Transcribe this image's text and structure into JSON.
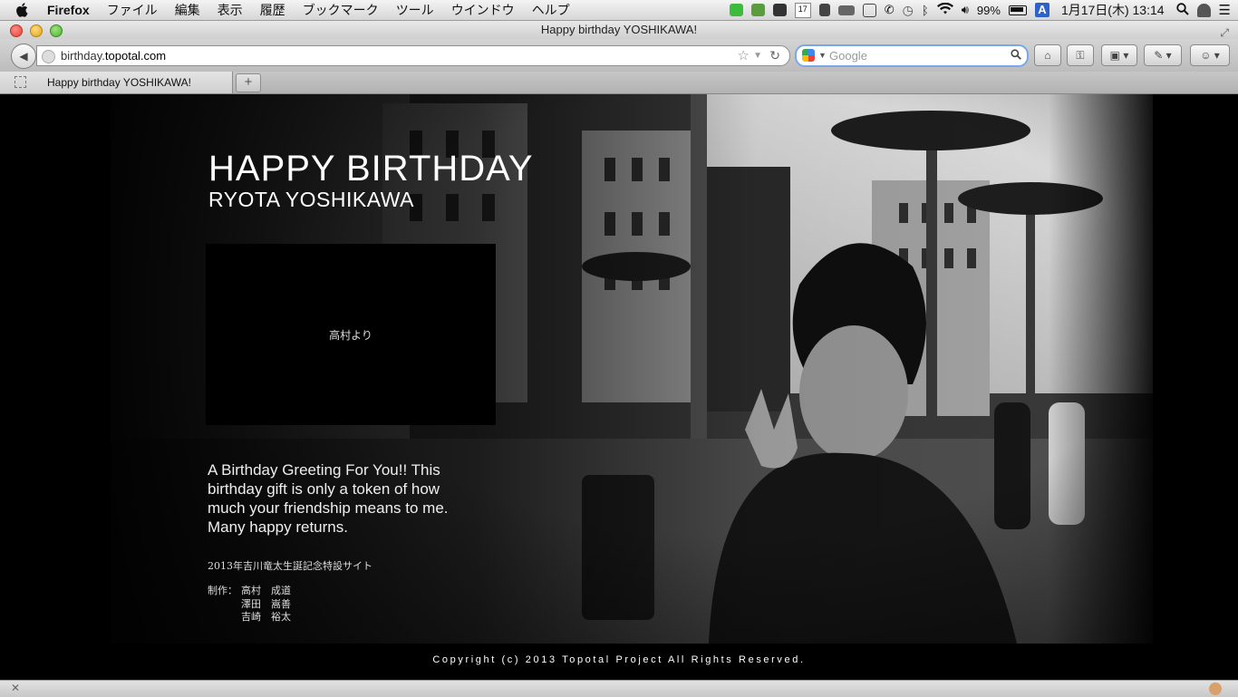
{
  "menubar": {
    "app": "Firefox",
    "items": [
      "ファイル",
      "編集",
      "表示",
      "履歴",
      "ブックマーク",
      "ツール",
      "ウインドウ",
      "ヘルプ"
    ],
    "calendar_day": "17",
    "battery": "99%",
    "input_method": "A",
    "clock": "1月17日(木)  13:14"
  },
  "window": {
    "title": "Happy birthday YOSHIKAWA!"
  },
  "navbar": {
    "url_prefix": "birthday.",
    "url_domain": "topotal.com",
    "search_placeholder": "Google"
  },
  "tabs": [
    {
      "label": "Happy birthday YOSHIKAWA!",
      "active": true
    }
  ],
  "newtab_label": "+",
  "page": {
    "headline": "HAPPY BIRTHDAY",
    "subline": "RYOTA YOSHIKAWA",
    "message_from": "高村より",
    "greeting": "A Birthday Greeting For You!! This birthday gift is only a token of how much your friendship means to me. Many happy returns.",
    "site_note": "2013年吉川竜太生誕記念特設サイト",
    "credits_label": "制作：",
    "credits": [
      "高村　成道",
      "澤田　嵩善",
      "吉崎　裕太"
    ],
    "copyright": "Copyright (c) 2013 Topotal Project All Rights Reserved."
  },
  "colors": {
    "page_bg": "#000000",
    "text": "#ffffff",
    "search_focus": "#7aa7e6"
  },
  "icons": [
    "apple-icon",
    "line-icon",
    "evernote-icon",
    "adobe-icon",
    "calendar-icon",
    "clipboard-icon",
    "airplay-icon",
    "grid-icon",
    "phone-icon",
    "time-machine-icon",
    "bluetooth-icon",
    "wifi-icon",
    "volume-icon",
    "battery-icon",
    "user-icon",
    "spotlight-icon",
    "list-icon",
    "back-icon",
    "globe-icon",
    "star-icon",
    "reload-icon",
    "google-icon",
    "search-icon",
    "home-icon",
    "lock-icon",
    "bookmark-icon",
    "tool-icon",
    "addon-icon"
  ]
}
